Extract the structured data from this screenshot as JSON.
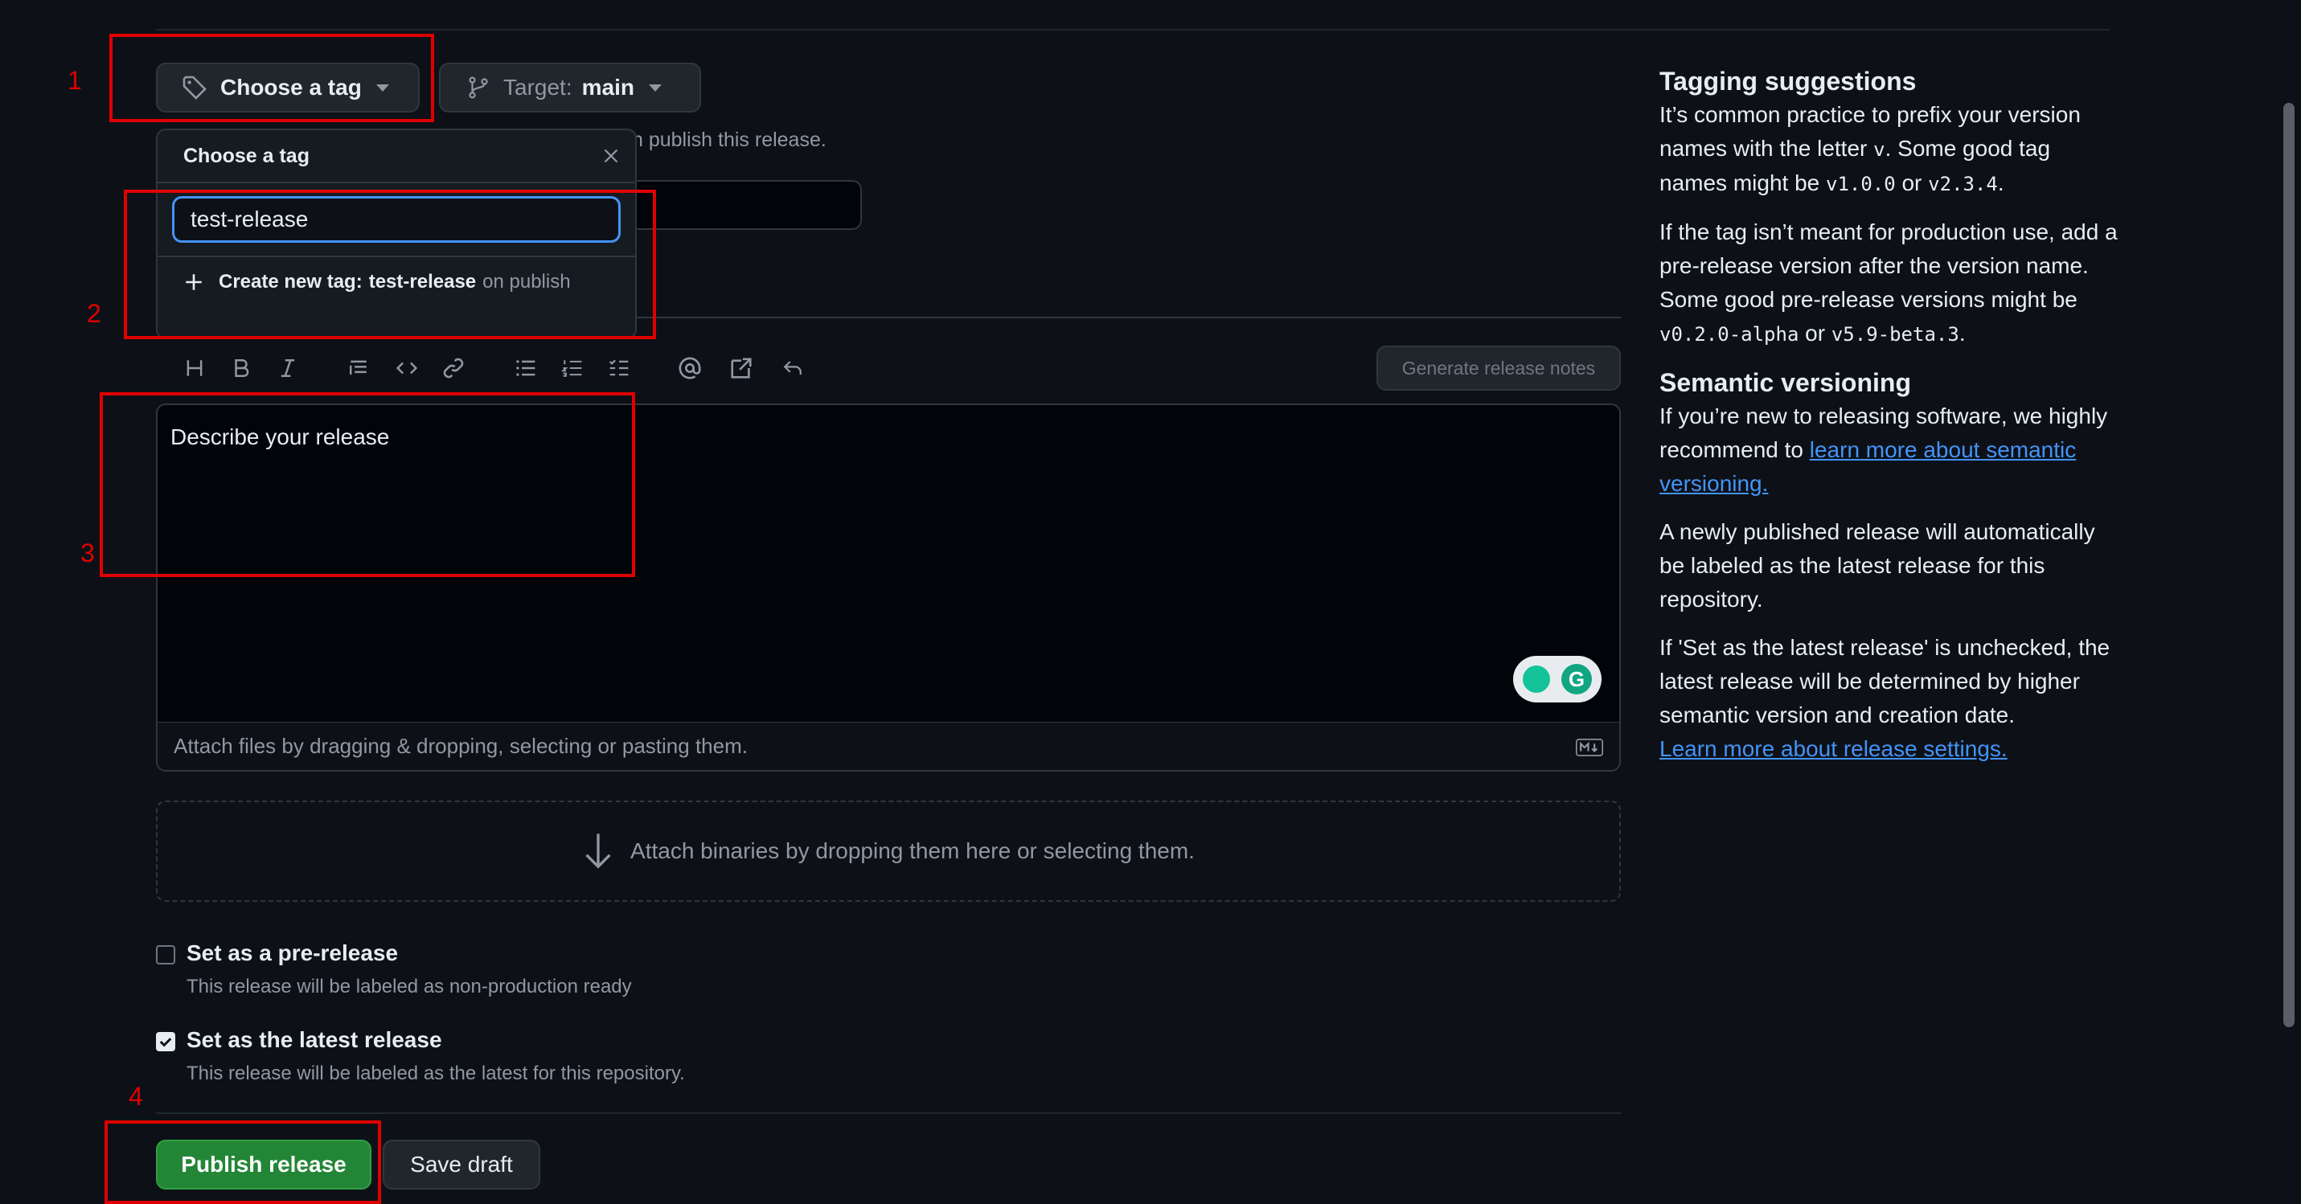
{
  "tag_button": {
    "label": "Choose a tag"
  },
  "target_button": {
    "prefix": "Target:",
    "branch": "main"
  },
  "behind_text": "n publish this release.",
  "popover": {
    "title": "Choose a tag",
    "input_value": "test-release",
    "create_prefix": "Create new tag:",
    "create_tag": "test-release",
    "create_suffix": "on publish"
  },
  "toolbar": {
    "generate_label": "Generate release notes"
  },
  "editor": {
    "placeholder": "Describe your release"
  },
  "attach_text": "Attach files by dragging & dropping, selecting or pasting them.",
  "dropzone_text": "Attach binaries by dropping them here or selecting them.",
  "prerelease": {
    "label": "Set as a pre-release",
    "hint": "This release will be labeled as non-production ready",
    "checked": false
  },
  "latest": {
    "label": "Set as the latest release",
    "hint": "This release will be labeled as the latest for this repository.",
    "checked": true
  },
  "actions": {
    "publish": "Publish release",
    "save": "Save draft"
  },
  "annotations": [
    "1",
    "2",
    "3",
    "4"
  ],
  "sidebar": {
    "tagging_title": "Tagging suggestions",
    "tagging_p1_a": "It’s common practice to prefix your version names with the letter ",
    "tagging_p1_v": "v",
    "tagging_p1_b": ". Some good tag names might be ",
    "tagging_p1_c1": "v1.0.0",
    "tagging_p1_or": " or ",
    "tagging_p1_c2": "v2.3.4",
    "tagging_p1_end": ".",
    "tagging_p2_a": "If the tag isn’t meant for production use, add a pre-release version after the version name. Some good pre-release versions might be ",
    "tagging_p2_c1": "v0.2.0-alpha",
    "tagging_p2_or": " or ",
    "tagging_p2_c2": "v5.9-beta.3",
    "tagging_p2_end": ".",
    "semver_title": "Semantic versioning",
    "semver_p1_a": "If you’re new to releasing software, we highly recommend to ",
    "semver_link": "learn more about semantic versioning.",
    "semver_p2": "A newly published release will automatically be labeled as the latest release for this repository.",
    "semver_p3": "If 'Set as the latest release' is unchecked, the latest release will be determined by higher semantic version and creation date.",
    "settings_link": "Learn more about release settings."
  }
}
